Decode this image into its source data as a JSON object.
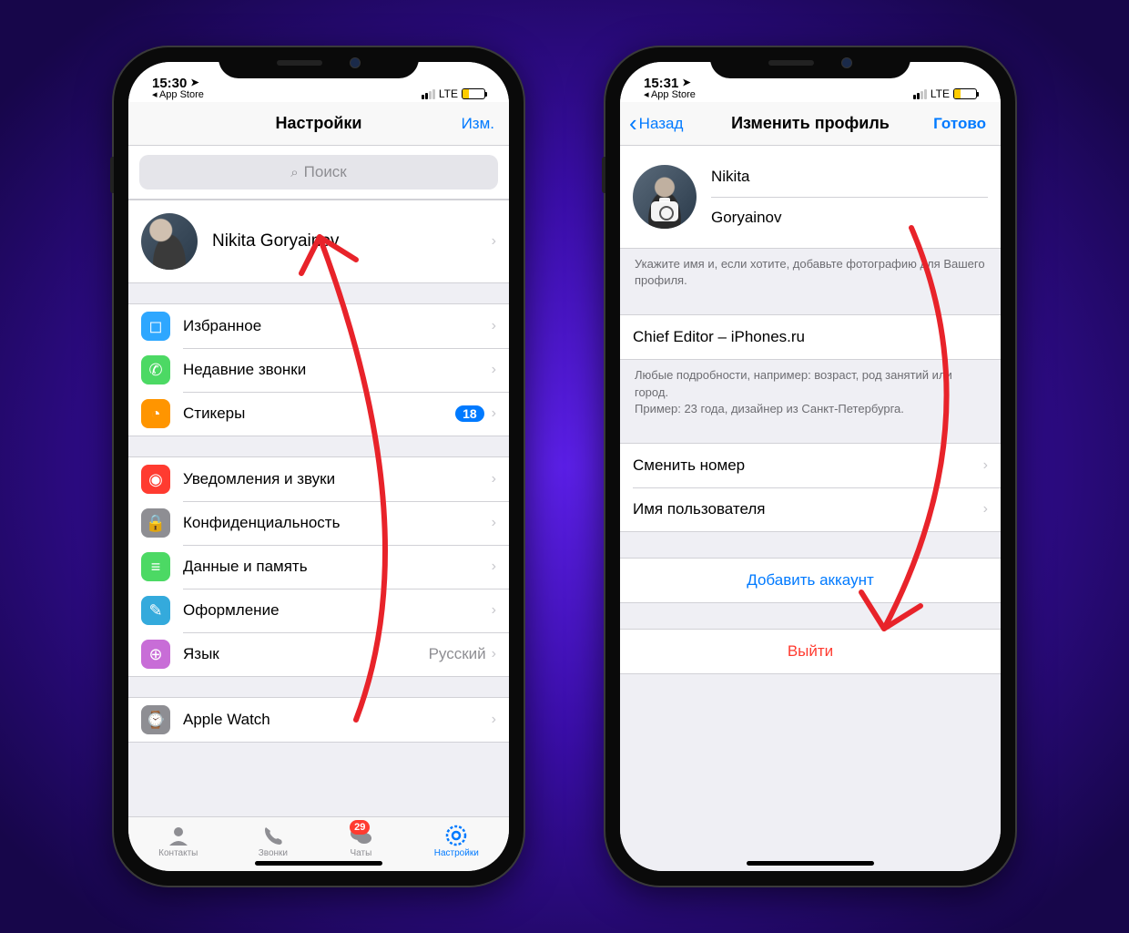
{
  "phone1": {
    "status": {
      "time": "15:30",
      "back_app": "◂ App Store",
      "lte": "LTE"
    },
    "nav": {
      "title": "Настройки",
      "edit": "Изм."
    },
    "search": {
      "placeholder": "Поиск"
    },
    "profile": {
      "name": "Nikita Goryainov"
    },
    "group1": {
      "favorites": "Избранное",
      "recent_calls": "Недавние звонки",
      "stickers": "Стикеры",
      "stickers_badge": "18"
    },
    "group2": {
      "notifications": "Уведомления и звуки",
      "privacy": "Конфиденциальность",
      "data": "Данные и память",
      "appearance": "Оформление",
      "language": "Язык",
      "language_value": "Русский"
    },
    "group3": {
      "apple_watch": "Apple Watch"
    },
    "tabs": {
      "contacts": "Контакты",
      "calls": "Звонки",
      "chats": "Чаты",
      "chats_badge": "29",
      "settings": "Настройки"
    }
  },
  "phone2": {
    "status": {
      "time": "15:31",
      "back_app": "◂ App Store",
      "lte": "LTE"
    },
    "nav": {
      "back": "Назад",
      "title": "Изменить профиль",
      "done": "Готово"
    },
    "fields": {
      "first_name": "Nikita",
      "last_name": "Goryainov"
    },
    "hint1": "Укажите имя и, если хотите, добавьте фотографию для Вашего профиля.",
    "bio": "Chief Editor – iPhones.ru",
    "hint2a": "Любые подробности, например: возраст, род занятий или город.",
    "hint2b": "Пример: 23 года, дизайнер из Санкт-Петербурга.",
    "change_number": "Сменить номер",
    "username": "Имя пользователя",
    "add_account": "Добавить аккаунт",
    "logout": "Выйти"
  }
}
